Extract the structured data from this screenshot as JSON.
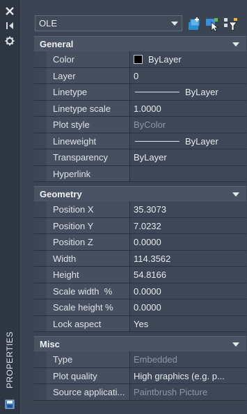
{
  "side_label": "PROPERTIES",
  "selector": {
    "value": "OLE"
  },
  "sections": {
    "general": {
      "title": "General",
      "rows": [
        {
          "label": "Color",
          "value": "ByLayer",
          "swatch": "#000000"
        },
        {
          "label": "Layer",
          "value": "0"
        },
        {
          "label": "Linetype",
          "value": "ByLayer"
        },
        {
          "label": "Linetype scale",
          "value": "1.0000"
        },
        {
          "label": "Plot style",
          "value": "ByColor"
        },
        {
          "label": "Lineweight",
          "value": "ByLayer"
        },
        {
          "label": "Transparency",
          "value": "ByLayer"
        },
        {
          "label": "Hyperlink",
          "value": ""
        }
      ]
    },
    "geometry": {
      "title": "Geometry",
      "rows": [
        {
          "label": "Position X",
          "value": "35.3073"
        },
        {
          "label": "Position Y",
          "value": "7.0232"
        },
        {
          "label": "Position Z",
          "value": "0.0000"
        },
        {
          "label": "Width",
          "value": "114.3562"
        },
        {
          "label": "Height",
          "value": "54.8166"
        },
        {
          "label": "Scale width  %",
          "value": "0.0000"
        },
        {
          "label": "Scale height %",
          "value": "0.0000"
        },
        {
          "label": "Lock aspect",
          "value": "Yes"
        }
      ]
    },
    "misc": {
      "title": "Misc",
      "rows": [
        {
          "label": "Type",
          "value": "Embedded"
        },
        {
          "label": "Plot quality",
          "value": "High graphics (e.g. p..."
        },
        {
          "label": "Source applicati...",
          "value": "Paintbrush Picture"
        }
      ]
    }
  },
  "colors": {
    "accent": "#2a8fd6",
    "panel_bg": "#3b4453",
    "header_bg": "#4a5364"
  }
}
